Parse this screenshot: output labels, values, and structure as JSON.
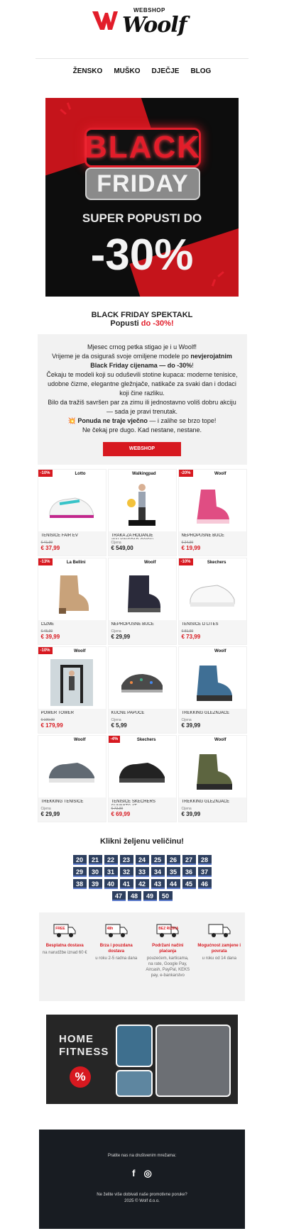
{
  "brand": {
    "small": "WEBSHOP",
    "name": "Woolf"
  },
  "nav": [
    "ŽENSKO",
    "MUŠKO",
    "DJEČJE",
    "BLOG"
  ],
  "banner": {
    "line1": "BLACK",
    "line2": "FRIDAY",
    "line3": "SUPER POPUSTI DO",
    "line4": "-30%"
  },
  "title": {
    "line1": "BLACK FRIDAY SPEKTAKL",
    "line2a": "Popusti ",
    "line2b": "do -30%!"
  },
  "intro": {
    "p1": "Mjesec crnog petka stigao je i u Woolf!",
    "p2a": "Vrijeme je da osiguraš svoje omiljene modele po ",
    "p2b": "nevjerojatnim Black Friday cijenama — do -30%",
    "p2c": "!",
    "p3": "Čekaju te modeli koji su oduševili stotine kupaca: moderne tenisice, udobne čizme, elegantne gležnjače, natikače za svaki dan i dodaci koji čine razliku.",
    "p4": "Bilo da tražiš savršen par za zimu ili jednostavno voliš dobru akciju — sada je pravi trenutak.",
    "p5a": "💥 ",
    "p5b": "Ponuda ne traje vječno",
    "p5c": " — i zalihe se brzo tope!",
    "p6": "Ne čekaj pre dugo. Kad nestane, nestane.",
    "button": "WEBSHOP"
  },
  "products": [
    {
      "name": "TENISICE FAIR EV",
      "discount": "-10%",
      "brand": "Lotto",
      "old": "€ 41,99",
      "price": "€ 37,99",
      "sale": true
    },
    {
      "name": "TRAKA ZA HODANJE Walkingpad C2(S1)",
      "discount": "",
      "brand": "Walkingpad",
      "label": "Cijena",
      "price": "€ 549,00",
      "sale": false
    },
    {
      "name": "NEPROPUSNE BUCE",
      "discount": "-20%",
      "brand": "Woolf",
      "old": "€ 24,99",
      "price": "€ 19,99",
      "sale": true
    },
    {
      "name": "ČIZME",
      "discount": "-13%",
      "brand": "La Bellini",
      "old": "€ 45,99",
      "price": "€ 39,99",
      "sale": true
    },
    {
      "name": "NEPROPUSNE BUCE",
      "discount": "",
      "brand": "Woolf",
      "label": "Cijena",
      "price": "€ 29,99",
      "sale": false
    },
    {
      "name": "TENISICE D LITES",
      "discount": "-10%",
      "brand": "Skechers",
      "old": "€ 81,99",
      "price": "€ 73,99",
      "sale": true
    },
    {
      "name": "POWER TOWER",
      "discount": "-10%",
      "brand": "Woolf",
      "old": "€ 199,99",
      "price": "€ 179,99",
      "sale": true
    },
    {
      "name": "KUĆNE PAPUČE",
      "discount": "",
      "brand": "",
      "label": "Cijena",
      "price": "€ 5,99",
      "sale": false
    },
    {
      "name": "TREKKING GLEŽNJAČE",
      "discount": "",
      "brand": "Woolf",
      "label": "Cijena",
      "price": "€ 39,99",
      "sale": false
    },
    {
      "name": "TREKKING TENISICE",
      "discount": "",
      "brand": "Woolf",
      "label": "Cijena",
      "price": "€ 29,99",
      "sale": false
    },
    {
      "name": "TENISICE SKECHERS SUMMITS AT",
      "discount": "-4%",
      "brand": "Skechers",
      "old": "€ 72,99",
      "price": "€ 69,99",
      "sale": true
    },
    {
      "name": "TREKKING GLEŽNJAČE",
      "discount": "",
      "brand": "Woolf",
      "label": "Cijena",
      "price": "€ 39,99",
      "sale": false
    }
  ],
  "sizes_title": "Klikni željenu veličinu!",
  "sizes": [
    "20",
    "21",
    "22",
    "23",
    "24",
    "25",
    "26",
    "27",
    "28",
    "29",
    "30",
    "31",
    "32",
    "33",
    "34",
    "35",
    "36",
    "37",
    "38",
    "39",
    "40",
    "41",
    "42",
    "43",
    "44",
    "45",
    "46",
    "47",
    "48",
    "49",
    "50"
  ],
  "benefits": [
    {
      "icon": "truck-free-icon",
      "icon_text": "FREE",
      "title": "Besplatna dostava",
      "desc": "na narudžbe iznad 60 €"
    },
    {
      "icon": "truck-48h-icon",
      "icon_text": "48h",
      "title": "Brza i pouzdana dostava",
      "desc": "u roku 2-5 radna dana"
    },
    {
      "icon": "no-risk-icon",
      "icon_text": "BEZ RIZIKA",
      "title": "Podržani načini plaćanja",
      "desc": "pouzećem, karticama, na rate, Google Pay, Aircash, PayPal, KEKS pay, e-bankarstvo"
    },
    {
      "icon": "card-return-icon",
      "icon_text": "",
      "title": "Mogućnost zamjene i povrata",
      "desc": "u roku od 14 dana"
    }
  ],
  "fitness": {
    "line1": "HOME",
    "line2": "FITNESS",
    "badge": "%"
  },
  "footer": {
    "follow": "Pratite nas na društvenim mrežama:",
    "facebook": "f",
    "instagram": "◎",
    "unsub": "Ne želite više dobivati naše promotivne poruke?",
    "copyright": "2025 © Wolf d.o.o."
  },
  "colors": {
    "accent": "#d71920",
    "size_bg": "#2d3f5f",
    "footer_bg": "#181c22"
  }
}
